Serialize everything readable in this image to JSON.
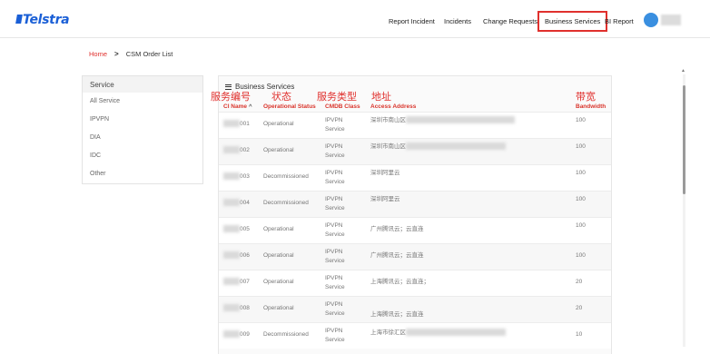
{
  "header": {
    "brand": "Telstra",
    "nav": [
      {
        "label": "Report Incident"
      },
      {
        "label": "Incidents"
      },
      {
        "label": "Change Requests"
      },
      {
        "label": "Business Services"
      },
      {
        "label": "BI Report"
      }
    ]
  },
  "breadcrumb": {
    "home": "Home",
    "separator": ">",
    "current": "CSM Order List"
  },
  "sidebar": {
    "title": "Service",
    "items": [
      {
        "label": "All Service"
      },
      {
        "label": "IPVPN"
      },
      {
        "label": "DIA"
      },
      {
        "label": "IDC"
      },
      {
        "label": "Other"
      }
    ]
  },
  "table": {
    "title": "Business Services",
    "columns": {
      "ci_name": "CI Name",
      "sort_arrow": "^",
      "status": "Operational Status",
      "cmdb_class": "CMDB Class",
      "address": "Access Address",
      "bandwidth": "Bandwidth"
    },
    "annotations": {
      "ci_name": "服务编号",
      "status": "状态",
      "cmdb_class": "服务类型",
      "address": "地址",
      "bandwidth": "带宽"
    },
    "rows": [
      {
        "ci_suffix": "001",
        "status": "Operational",
        "cls1": "IPVPN",
        "cls2": "Service",
        "address": "深圳市南山区",
        "bandwidth": "100"
      },
      {
        "ci_suffix": "002",
        "status": "Operational",
        "cls1": "IPVPN",
        "cls2": "Service",
        "address": "深圳市南山区",
        "bandwidth": "100"
      },
      {
        "ci_suffix": "003",
        "status": "Decommissioned",
        "cls1": "IPVPN",
        "cls2": "Service",
        "address": "深圳阿里云",
        "bandwidth": "100"
      },
      {
        "ci_suffix": "004",
        "status": "Decommissioned",
        "cls1": "IPVPN",
        "cls2": "Service",
        "address": "深圳阿里云",
        "bandwidth": "100"
      },
      {
        "ci_suffix": "005",
        "status": "Operational",
        "cls1": "IPVPN",
        "cls2": "Service",
        "address": "广州腾讯云；云直连",
        "bandwidth": "100"
      },
      {
        "ci_suffix": "006",
        "status": "Operational",
        "cls1": "IPVPN",
        "cls2": "Service",
        "address": "广州腾讯云；云直连",
        "bandwidth": "100"
      },
      {
        "ci_suffix": "007",
        "status": "Operational",
        "cls1": "IPVPN",
        "cls2": "Service",
        "address": "上海腾讯云；云直连；",
        "bandwidth": "20"
      },
      {
        "ci_suffix": "008",
        "status": "Operational",
        "cls1": "IPVPN",
        "cls2": "Service",
        "address": "上海腾讯云；云直连",
        "bandwidth": "20"
      },
      {
        "ci_suffix": "009",
        "status": "Decommissioned",
        "cls1": "IPVPN",
        "cls2": "Service",
        "address": "上海市徐汇区",
        "bandwidth": "10"
      }
    ]
  },
  "colors": {
    "brand": "#1a5fd6",
    "accent": "#e0302d",
    "header_text": "#d9342b"
  }
}
